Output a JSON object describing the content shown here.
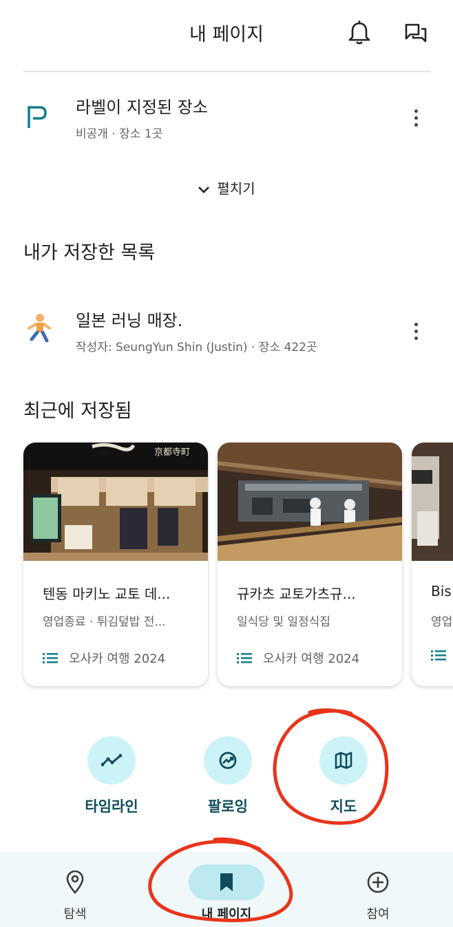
{
  "header": {
    "title": "내 페이지"
  },
  "labeled": {
    "title": "라벨이 지정된 장소",
    "subtitle": "비공개 · 장소 1곳"
  },
  "expand_label": "펼치기",
  "saved_lists": {
    "section_title": "내가 저장한 목록",
    "items": [
      {
        "title": "일본 러닝 매장.",
        "subtitle": "작성자: SeungYun Shin (Justin) · 장소 422곳"
      }
    ]
  },
  "recent": {
    "section_title": "최근에 저장됨",
    "cards": [
      {
        "title": "텐동 마키노 교토 데...",
        "subtitle": "영업종료 · 튀김덮밥 전...",
        "list": "오사카 여행 2024",
        "image_text": "京都寺町"
      },
      {
        "title": "규카츠 교토가츠규...",
        "subtitle": "일식당 및 일정식집",
        "list": "오사카 여행 2024"
      },
      {
        "title": "Bis",
        "subtitle": "영업",
        "list": ""
      }
    ]
  },
  "actions": [
    {
      "label": "타임라인",
      "icon": "timeline-icon"
    },
    {
      "label": "팔로잉",
      "icon": "following-icon"
    },
    {
      "label": "지도",
      "icon": "map-icon"
    }
  ],
  "nav": [
    {
      "label": "탐색",
      "icon": "location-pin-icon"
    },
    {
      "label": "내 페이지",
      "icon": "bookmark-icon",
      "active": true
    },
    {
      "label": "참여",
      "icon": "add-circle-icon"
    }
  ],
  "colors": {
    "accent": "#0f7d8c",
    "action_bg": "#ccf3f8",
    "nav_bg": "#f0f8f9",
    "annotation": "#e8341c"
  }
}
